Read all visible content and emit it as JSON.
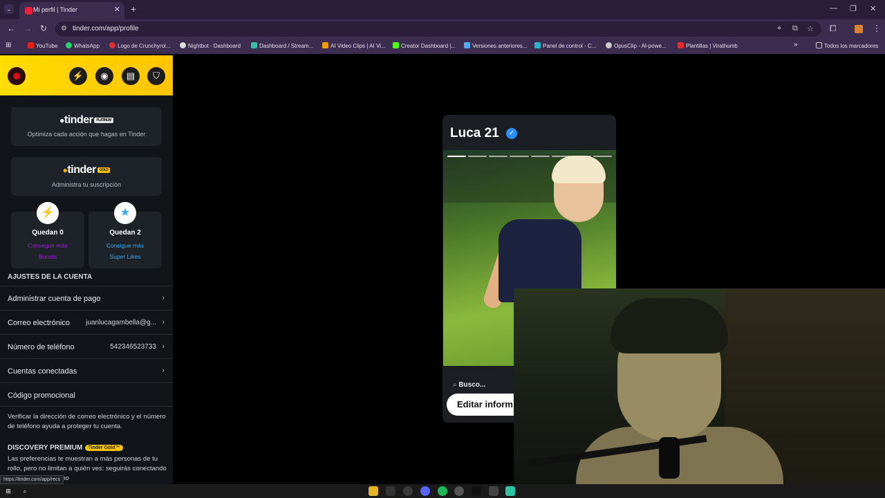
{
  "browser": {
    "tab_title": "Mi perfil | Tinder",
    "url": "tinder.com/app/profile",
    "status_url": "https://tinder.com/app/recs",
    "bookmarks": [
      {
        "label": "YouTube",
        "color": "#e62117"
      },
      {
        "label": "WhatsApp",
        "color": "#25d366"
      },
      {
        "label": "Logo de Crunchyrol...",
        "color": "#e03131"
      },
      {
        "label": "Nightbot - Dashboard",
        "color": "#dddddd"
      },
      {
        "label": "Dashboard / Stream...",
        "color": "#2ec4a6"
      },
      {
        "label": "AI Video Clips | AI Vi...",
        "color": "#f59f00"
      },
      {
        "label": "Creator Dashboard |...",
        "color": "#53fc18"
      },
      {
        "label": "Versiones anteriores...",
        "color": "#4dabf7"
      },
      {
        "label": "Panel de control - C...",
        "color": "#22b8cf"
      },
      {
        "label": "OpusClip - AI-powe...",
        "color": "#cccccc"
      },
      {
        "label": "Plantillas | Virathumb",
        "color": "#e03131"
      }
    ],
    "all_bookmarks": "Todos los marcadores"
  },
  "sidebar": {
    "platinum": {
      "brand": "tinder",
      "badge": "PLATINUM",
      "subtitle": "Optimiza cada acción que hagas en Tinder"
    },
    "gold": {
      "brand": "tinder",
      "badge": "GOLD",
      "subtitle": "Administra tu suscripción"
    },
    "boosts": {
      "title": "Quedan 0",
      "link_line1": "Conseguir más",
      "link_line2": "Boosts",
      "color": "#a21cdb"
    },
    "superlikes": {
      "title": "Quedan 2",
      "link_line1": "Consigue más",
      "link_line2": "Super Likes",
      "color": "#37a7f2"
    },
    "account_section": "AJUSTES DE LA CUENTA",
    "rows": [
      {
        "label": "Administrar cuenta de pago",
        "value": ""
      },
      {
        "label": "Correo electrónico",
        "value": "juanlucagambella@g..."
      },
      {
        "label": "Número de teléfono",
        "value": "542346523733"
      },
      {
        "label": "Cuentas conectadas",
        "value": ""
      },
      {
        "label": "Código promocional",
        "value": ""
      }
    ],
    "verify_note": "Verificar la dirección de correo electrónico y el número de teléfono ayuda a proteger tu cuenta.",
    "discovery_title": "DISCOVERY PREMIUM",
    "discovery_badge": "Tinder Gold™",
    "discovery_text": "Las preferencias te muestran a más personas de tu rollo, pero no limitan a quién ves: seguirás conectando con personas que no"
  },
  "profile": {
    "name": "Luca 21",
    "photo_count": 8,
    "search_label": "Busco...",
    "edit_button": "Editar inform"
  },
  "colors": {
    "accent_yellow": "#ffc400",
    "tinder_red": "#fe3c72",
    "verified_blue": "#2b8fff"
  }
}
